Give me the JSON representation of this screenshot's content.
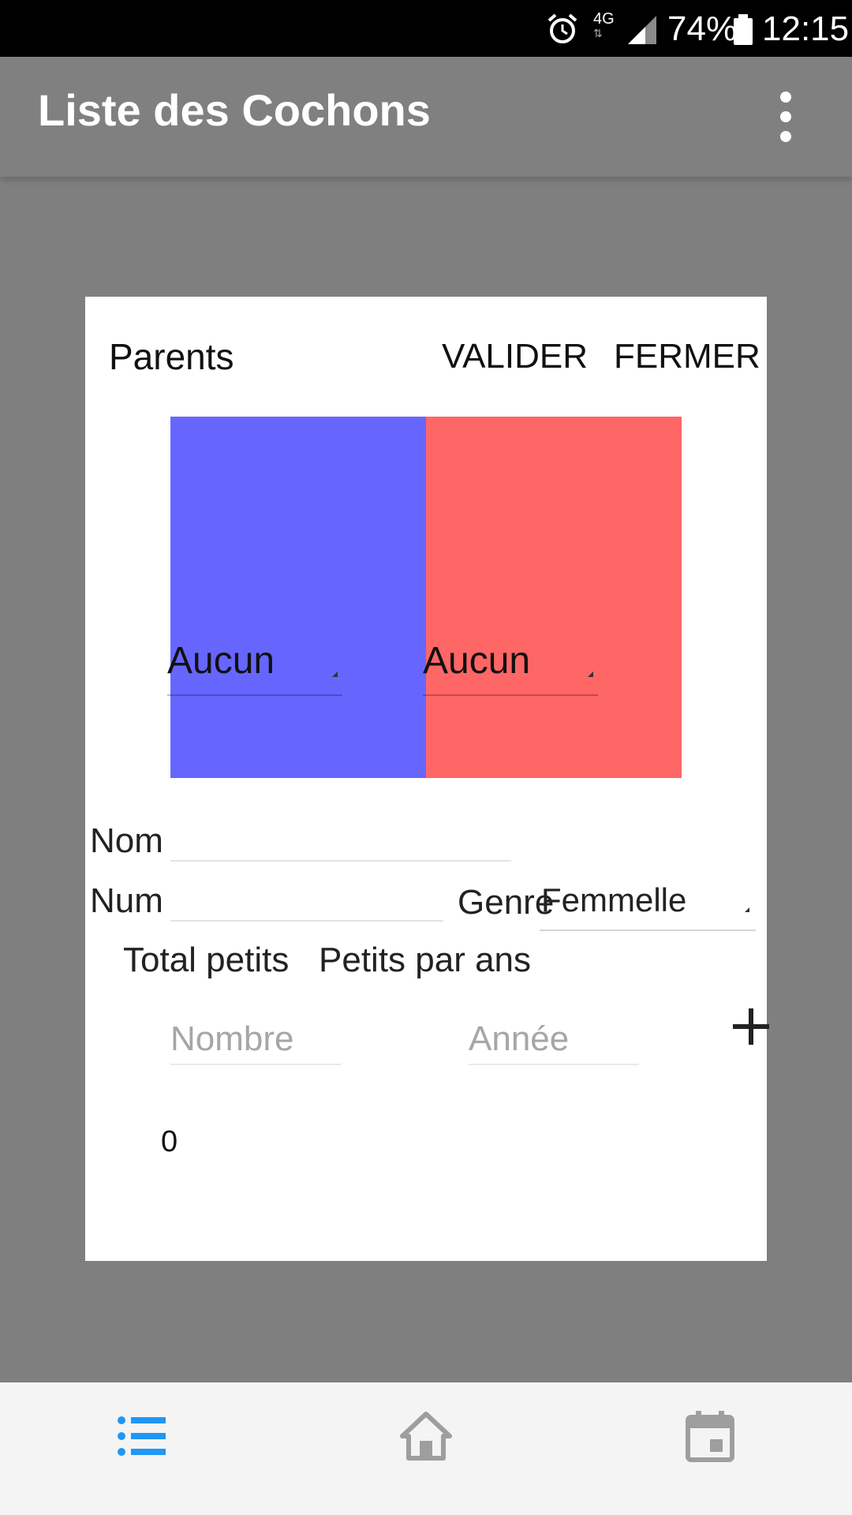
{
  "status_bar": {
    "network": "4G",
    "battery": "74%",
    "time": "12:15",
    "icons": [
      "alarm-icon",
      "network-4g-icon",
      "signal-icon",
      "battery-icon"
    ]
  },
  "app_bar": {
    "title": "Liste des Cochons",
    "menu_icon": "more-vert-icon"
  },
  "dialog": {
    "title": "Parents",
    "validate_label": "VALIDER",
    "close_label": "FERMER",
    "parents": {
      "father": {
        "value": "Aucun",
        "color": "#6666ff"
      },
      "mother": {
        "value": "Aucun",
        "color": "#ff6666"
      }
    },
    "nom_label": "Nom",
    "nom_value": "",
    "num_label": "Num",
    "num_value": "",
    "genre_label": "Genre",
    "genre_value": "Femmelle",
    "total_label": "Total petits",
    "per_year_label": "Petits par ans",
    "number_placeholder": "Nombre",
    "year_placeholder": "Année",
    "add_icon": "plus-icon",
    "total_value": "0"
  },
  "bottom_nav": {
    "items": [
      {
        "icon": "list-icon",
        "active": true,
        "color": "#2196f3"
      },
      {
        "icon": "home-icon",
        "active": false,
        "color": "#9e9e9e"
      },
      {
        "icon": "calendar-icon",
        "active": false,
        "color": "#9e9e9e"
      }
    ]
  },
  "colors": {
    "scrim": "#7f7f7f",
    "accent": "#2196f3"
  }
}
